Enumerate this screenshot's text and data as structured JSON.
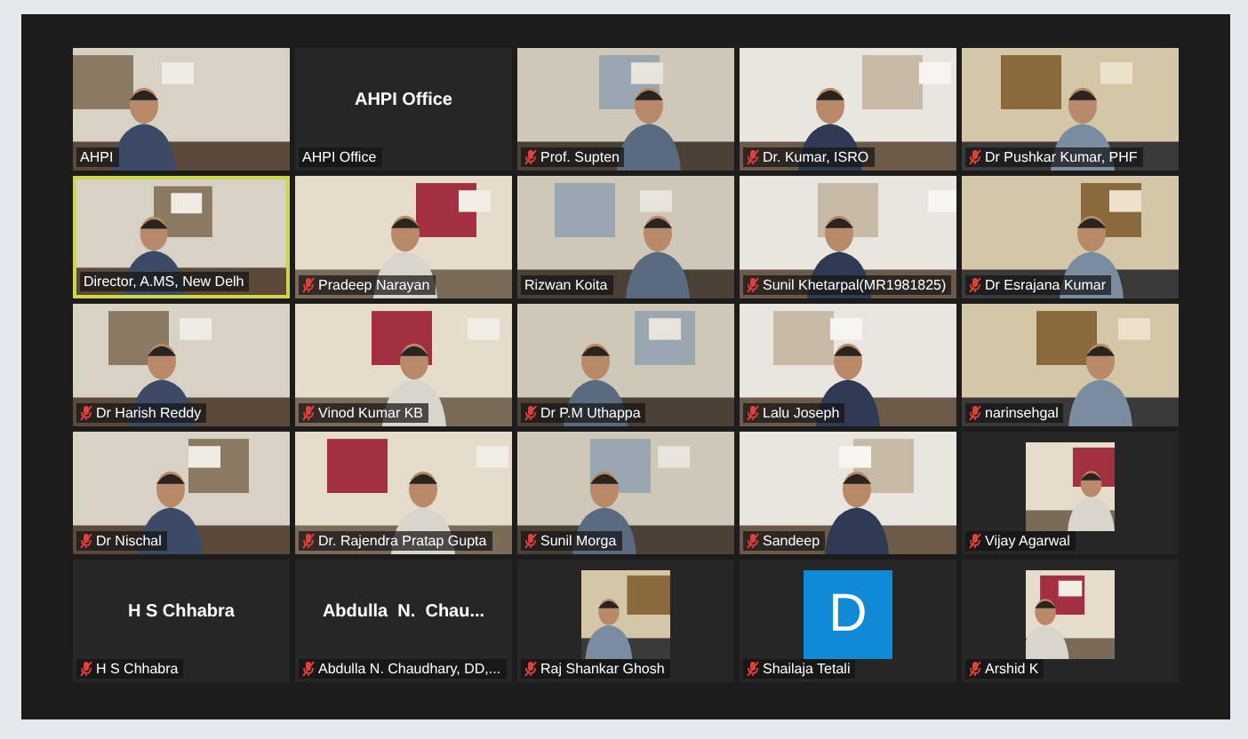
{
  "tiles": [
    {
      "kind": "video",
      "name": "AHPI",
      "muted": false,
      "speaking": false
    },
    {
      "kind": "name",
      "display": "AHPI Office",
      "name": "AHPI Office",
      "muted": false,
      "speaking": false
    },
    {
      "kind": "video",
      "name": "Prof. Supten",
      "muted": true,
      "speaking": false
    },
    {
      "kind": "video",
      "name": "Dr. Kumar, ISRO",
      "muted": true,
      "speaking": false
    },
    {
      "kind": "video",
      "name": "Dr Pushkar Kumar, PHF",
      "muted": true,
      "speaking": false
    },
    {
      "kind": "video",
      "name": "Director, A.MS, New Delh",
      "muted": false,
      "speaking": true
    },
    {
      "kind": "video",
      "name": "Pradeep Narayan",
      "muted": true,
      "speaking": false
    },
    {
      "kind": "video",
      "name": "Rizwan Koita",
      "muted": false,
      "speaking": false
    },
    {
      "kind": "video",
      "name": "Sunil Khetarpal(MR1981825)",
      "muted": true,
      "speaking": false
    },
    {
      "kind": "video",
      "name": "Dr Esrajana Kumar",
      "muted": true,
      "speaking": false
    },
    {
      "kind": "video",
      "name": "Dr Harish Reddy",
      "muted": true,
      "speaking": false
    },
    {
      "kind": "video",
      "name": "Vinod Kumar KB",
      "muted": true,
      "speaking": false
    },
    {
      "kind": "video",
      "name": "Dr P.M Uthappa",
      "muted": true,
      "speaking": false
    },
    {
      "kind": "video",
      "name": "Lalu Joseph",
      "muted": true,
      "speaking": false
    },
    {
      "kind": "video",
      "name": "narinsehgal",
      "muted": true,
      "speaking": false
    },
    {
      "kind": "video",
      "name": "Dr Nischal",
      "muted": true,
      "speaking": false
    },
    {
      "kind": "video",
      "name": "Dr. Rajendra Pratap Gupta",
      "muted": true,
      "speaking": false
    },
    {
      "kind": "video",
      "name": "Sunil Morga",
      "muted": true,
      "speaking": false
    },
    {
      "kind": "video",
      "name": "Sandeep",
      "muted": true,
      "speaking": false
    },
    {
      "name": "Vijay Agarwal",
      "muted": true,
      "speaking": false
    },
    {
      "kind": "name",
      "display": "H S Chhabra",
      "name": "H S Chhabra",
      "muted": true,
      "speaking": false
    },
    {
      "kind": "name",
      "display": "Abdulla  N.  Chau...",
      "name": "Abdulla N. Chaudhary, DD,...",
      "muted": true,
      "speaking": false
    },
    {
      "name": "Raj Shankar Ghosh",
      "muted": true,
      "speaking": false
    },
    {
      "kind": "letter",
      "letter": "D",
      "name": "Shailaja Tetali",
      "muted": true,
      "speaking": false
    },
    {
      "name": "Arshid K",
      "muted": true,
      "speaking": false
    }
  ]
}
